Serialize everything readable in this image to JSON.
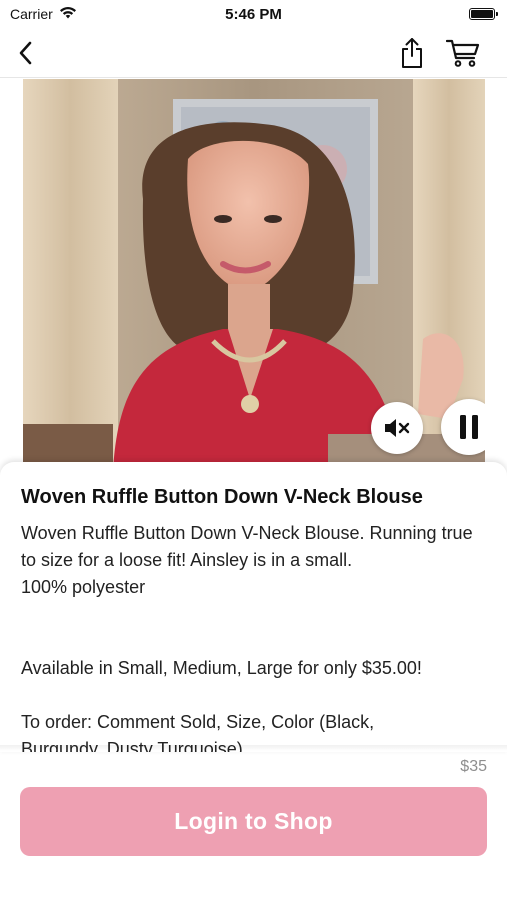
{
  "status_bar": {
    "carrier": "Carrier",
    "time": "5:46 PM",
    "icons": {
      "wifi": "wifi-icon",
      "battery": "battery-icon"
    }
  },
  "nav": {
    "back_icon": "chevron-left-icon",
    "share_icon": "share-icon",
    "cart_icon": "cart-icon"
  },
  "video": {
    "mute_icon": "speaker-muted-icon",
    "pause_icon": "pause-icon"
  },
  "product": {
    "title": "Woven Ruffle Button Down V-Neck Blouse",
    "description_lines": [
      "Woven Ruffle Button Down V-Neck Blouse. Running true to size for a loose fit! Ainsley is in a small.",
      "100% polyester",
      "",
      "",
      "Available in Small, Medium, Large for only $35.00!",
      "",
      "To order: Comment Sold, Size, Color (Black,",
      "Burgundy, Dusty Turquoise)"
    ]
  },
  "footer": {
    "price": "$35",
    "login_button": "Login to Shop"
  },
  "colors": {
    "login_button_bg": "#eea0b2",
    "price_text": "#8e8e8e",
    "blouse": "#c4283c"
  }
}
